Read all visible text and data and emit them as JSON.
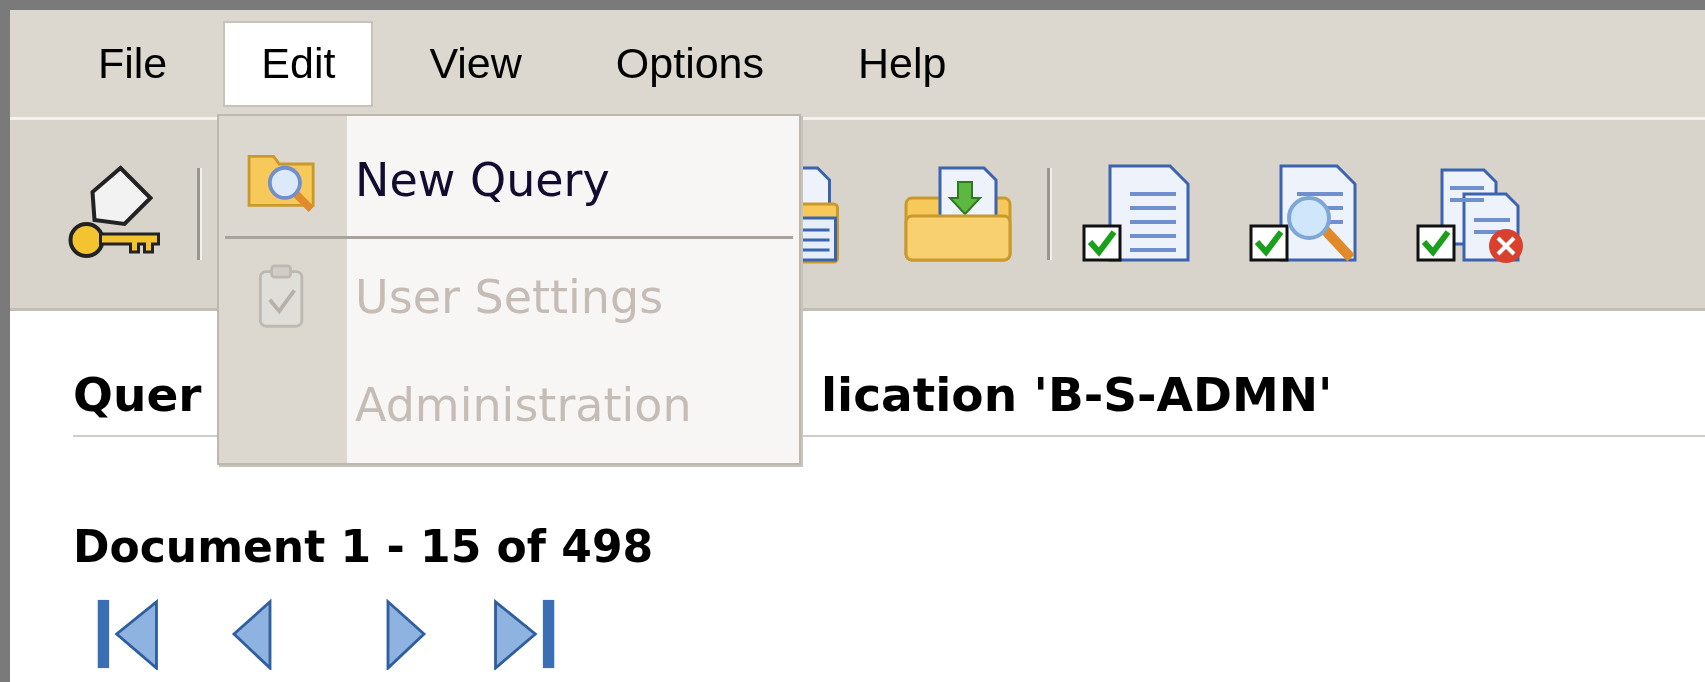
{
  "menu_bar": [
    {
      "label": "File",
      "selected": false
    },
    {
      "label": "Edit",
      "selected": true
    },
    {
      "label": "View",
      "selected": false
    },
    {
      "label": "Options",
      "selected": false
    },
    {
      "label": "Help",
      "selected": false
    }
  ],
  "edit_menu": [
    {
      "label": "New Query",
      "disabled": false,
      "separator_after": true
    },
    {
      "label": "User Settings",
      "disabled": true,
      "separator_after": false
    },
    {
      "label": "Administration",
      "disabled": true,
      "separator_after": false
    }
  ],
  "title_parts": [
    "Quer",
    "lication 'B-S-ADMN'"
  ],
  "document_range": "Document 1 - 15 of 498"
}
